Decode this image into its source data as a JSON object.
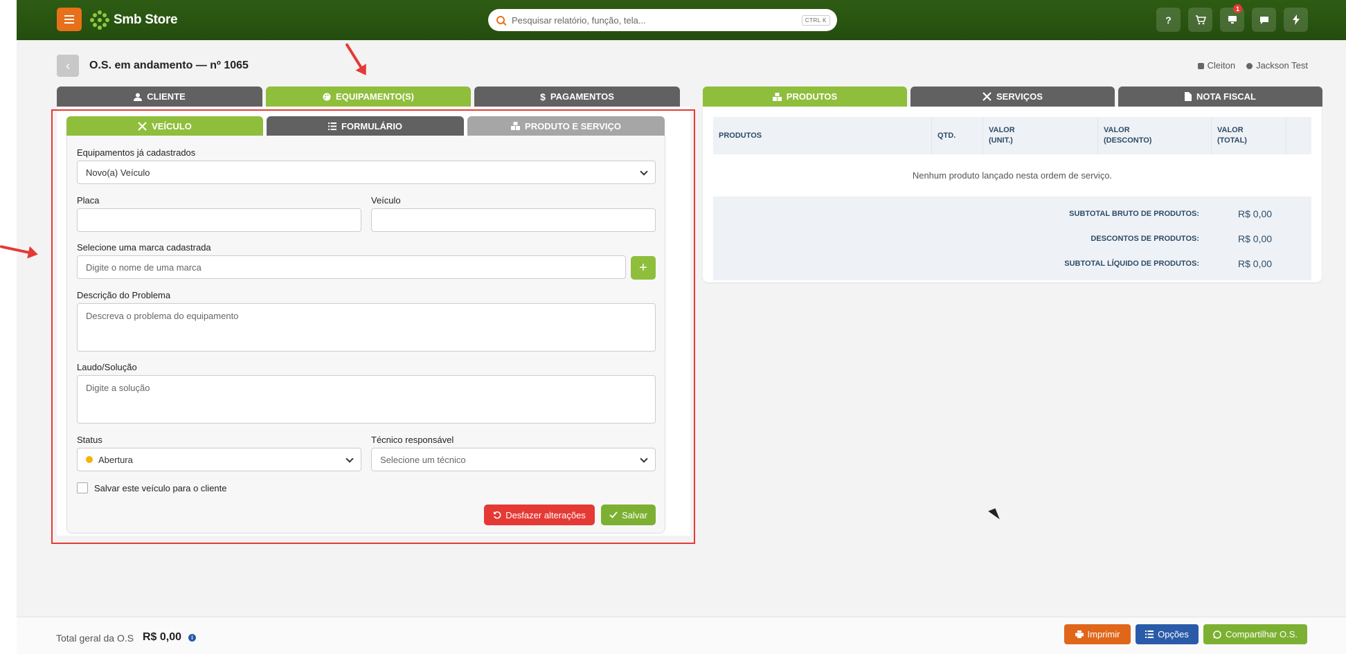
{
  "header": {
    "brand_name": "Smb Store",
    "search_placeholder": "Pesquisar relatório, função, tela...",
    "search_shortcut": "CTRL K",
    "notification_count": "1",
    "icons": [
      "help-icon",
      "cart-icon",
      "monitor-icon",
      "chat-icon",
      "lightning-icon"
    ]
  },
  "page": {
    "title": "O.S. em andamento — nº 1065",
    "store_user": "Cleiton",
    "current_user": "Jackson Test"
  },
  "left_tabs": [
    {
      "label": "Cliente",
      "icon": "user-icon"
    },
    {
      "label": "Equipamento(s)",
      "icon": "palette-icon"
    },
    {
      "label": "Pagamentos",
      "icon": "dollar-icon"
    }
  ],
  "right_tabs": [
    {
      "label": "Produtos",
      "icon": "boxes-icon"
    },
    {
      "label": "Serviços",
      "icon": "tools-icon"
    },
    {
      "label": "Nota Fiscal",
      "icon": "document-icon"
    }
  ],
  "sub_tabs": [
    {
      "label": "Veículo",
      "icon": "tools-icon"
    },
    {
      "label": "Formulário",
      "icon": "list-icon"
    },
    {
      "label": "Produto e Serviço",
      "icon": "boxes-icon"
    }
  ],
  "form": {
    "equip_label": "Equipamentos já cadastrados",
    "equip_value": "Novo(a) Veículo",
    "placa_label": "Placa",
    "placa_value": "",
    "veiculo_label": "Veículo",
    "veiculo_value": "",
    "marca_label": "Selecione uma marca cadastrada",
    "marca_placeholder": "Digite o nome de uma marca",
    "descricao_label": "Descrição do Problema",
    "descricao_placeholder": "Descreva o problema do equipamento",
    "laudo_label": "Laudo/Solução",
    "laudo_placeholder": "Digite a solução",
    "status_label": "Status",
    "status_value": "Abertura",
    "status_color": "#f4b400",
    "tecnico_label": "Técnico responsável",
    "tecnico_placeholder": "Selecione um técnico",
    "save_vehicle_label": "Salvar este veículo para o cliente",
    "undo_label": "Desfazer alterações",
    "save_label": "Salvar"
  },
  "products": {
    "columns": [
      "PRODUTOS",
      "QTD.",
      "VALOR\n(UNIT.)",
      "VALOR\n(DESCONTO)",
      "VALOR\n(TOTAL)"
    ],
    "empty_message": "Nenhum produto lançado nesta ordem de serviço.",
    "totals": [
      {
        "label": "SUBTOTAL BRUTO DE PRODUTOS:",
        "value": "R$ 0,00"
      },
      {
        "label": "DESCONTOS DE PRODUTOS:",
        "value": "R$ 0,00"
      },
      {
        "label": "SUBTOTAL LÍQUIDO DE PRODUTOS:",
        "value": "R$ 0,00"
      }
    ]
  },
  "footer": {
    "total_label": "Total geral da O.S",
    "total_value": "R$ 0,00",
    "print_label": "Imprimir",
    "options_label": "Opções",
    "share_label": "Compartilhar O.S."
  },
  "colors": {
    "brand_green": "#8fbe3c",
    "topbar": "#2e5c14",
    "orange": "#e8701a",
    "danger": "#e53935",
    "blue": "#2a5ba8"
  }
}
